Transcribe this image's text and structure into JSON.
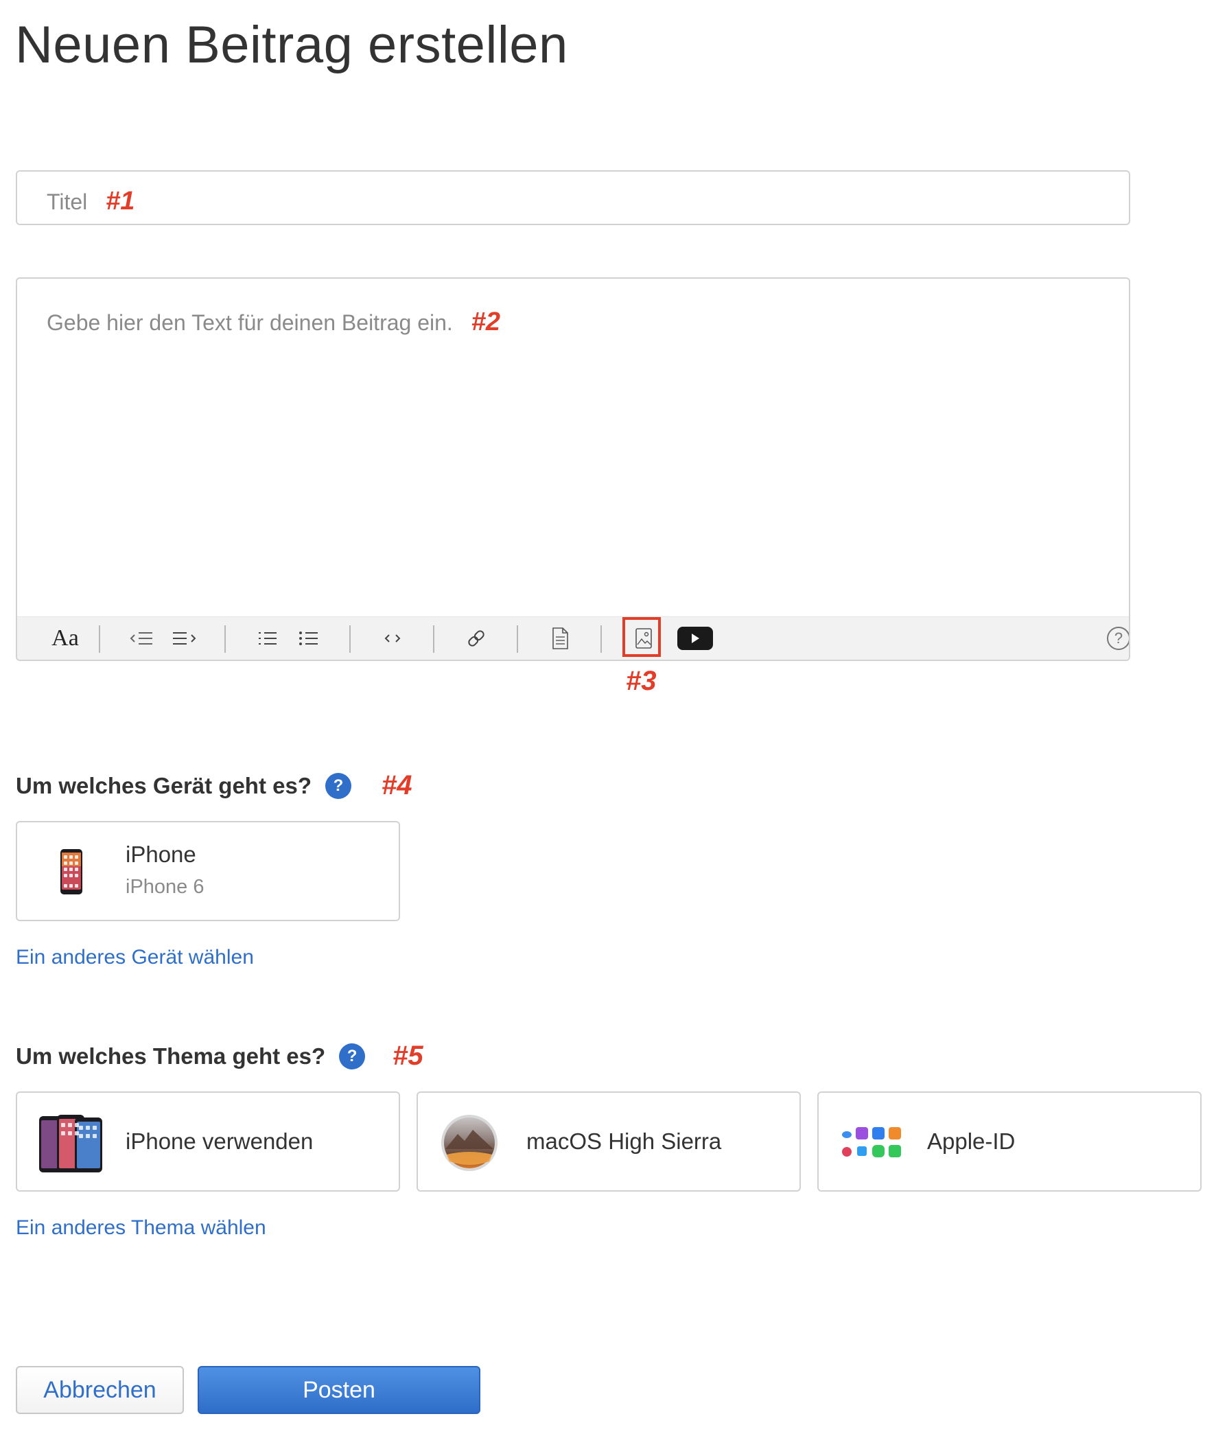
{
  "page": {
    "title": "Neuen Beitrag erstellen"
  },
  "title_field": {
    "placeholder": "Titel",
    "marker": "#1"
  },
  "editor": {
    "placeholder": "Gebe hier den Text für deinen Beitrag ein.",
    "marker": "#2",
    "toolbar": {
      "format_label": "Aa",
      "items": [
        "text-format-icon",
        "outdent-icon",
        "indent-icon",
        "numbered-list-icon",
        "bullet-list-icon",
        "code-icon",
        "link-icon",
        "document-icon",
        "image-icon",
        "video-icon",
        "help-icon"
      ],
      "highlight_marker": "#3"
    }
  },
  "device_section": {
    "heading": "Um welches Gerät geht es?",
    "marker": "#4",
    "help_symbol": "?",
    "device": {
      "name": "iPhone",
      "model": "iPhone 6"
    },
    "change_link": "Ein anderes Gerät wählen"
  },
  "topic_section": {
    "heading": "Um welches Thema geht es?",
    "marker": "#5",
    "help_symbol": "?",
    "topics": [
      {
        "label": "iPhone verwenden",
        "icon": "iphones-icon"
      },
      {
        "label": "macOS High Sierra",
        "icon": "macos-high-sierra-icon"
      },
      {
        "label": "Apple-ID",
        "icon": "apple-id-apps-icon"
      }
    ],
    "change_link": "Ein anderes Thema wählen"
  },
  "actions": {
    "cancel_label": "Abbrechen",
    "post_label": "Posten"
  },
  "colors": {
    "accent": "#2f6ec9",
    "marker": "#e23d28",
    "border": "#d2d2d2"
  }
}
